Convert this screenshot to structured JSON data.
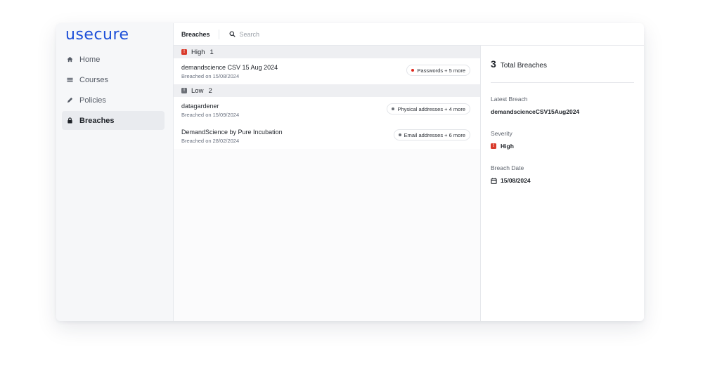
{
  "app": {
    "logo": "usecure"
  },
  "sidebar": {
    "items": [
      {
        "label": "Home",
        "icon": "home-icon"
      },
      {
        "label": "Courses",
        "icon": "courses-icon"
      },
      {
        "label": "Policies",
        "icon": "policies-icon"
      },
      {
        "label": "Breaches",
        "icon": "lock-icon",
        "active": true
      }
    ]
  },
  "topbar": {
    "title": "Breaches",
    "search_placeholder": "Search"
  },
  "groups": [
    {
      "severity": "High",
      "count": "1",
      "color": "#d93a2b",
      "rows": [
        {
          "name": "demandscience CSV 15 Aug 2024",
          "date": "Breached on 15/08/2024",
          "tag": "Passwords + 5 more",
          "dot_color": "#e0261b"
        }
      ]
    },
    {
      "severity": "Low",
      "count": "2",
      "color": "#6b6f76",
      "rows": [
        {
          "name": "datagardener",
          "date": "Breached on 15/09/2024",
          "tag": "Physical addresses + 4 more",
          "dot_color": "#6b6f76"
        },
        {
          "name": "DemandScience by Pure Incubation",
          "date": "Breached on 28/02/2024",
          "tag": "Email addresses + 6 more",
          "dot_color": "#6b6f76"
        }
      ]
    }
  ],
  "detail": {
    "total_count": "3",
    "total_label": "Total Breaches",
    "latest_label": "Latest Breach",
    "latest_value": "demandscienceCSV15Aug2024",
    "severity_label": "Severity",
    "severity_value": "High",
    "date_label": "Breach Date",
    "date_value": "15/08/2024"
  }
}
